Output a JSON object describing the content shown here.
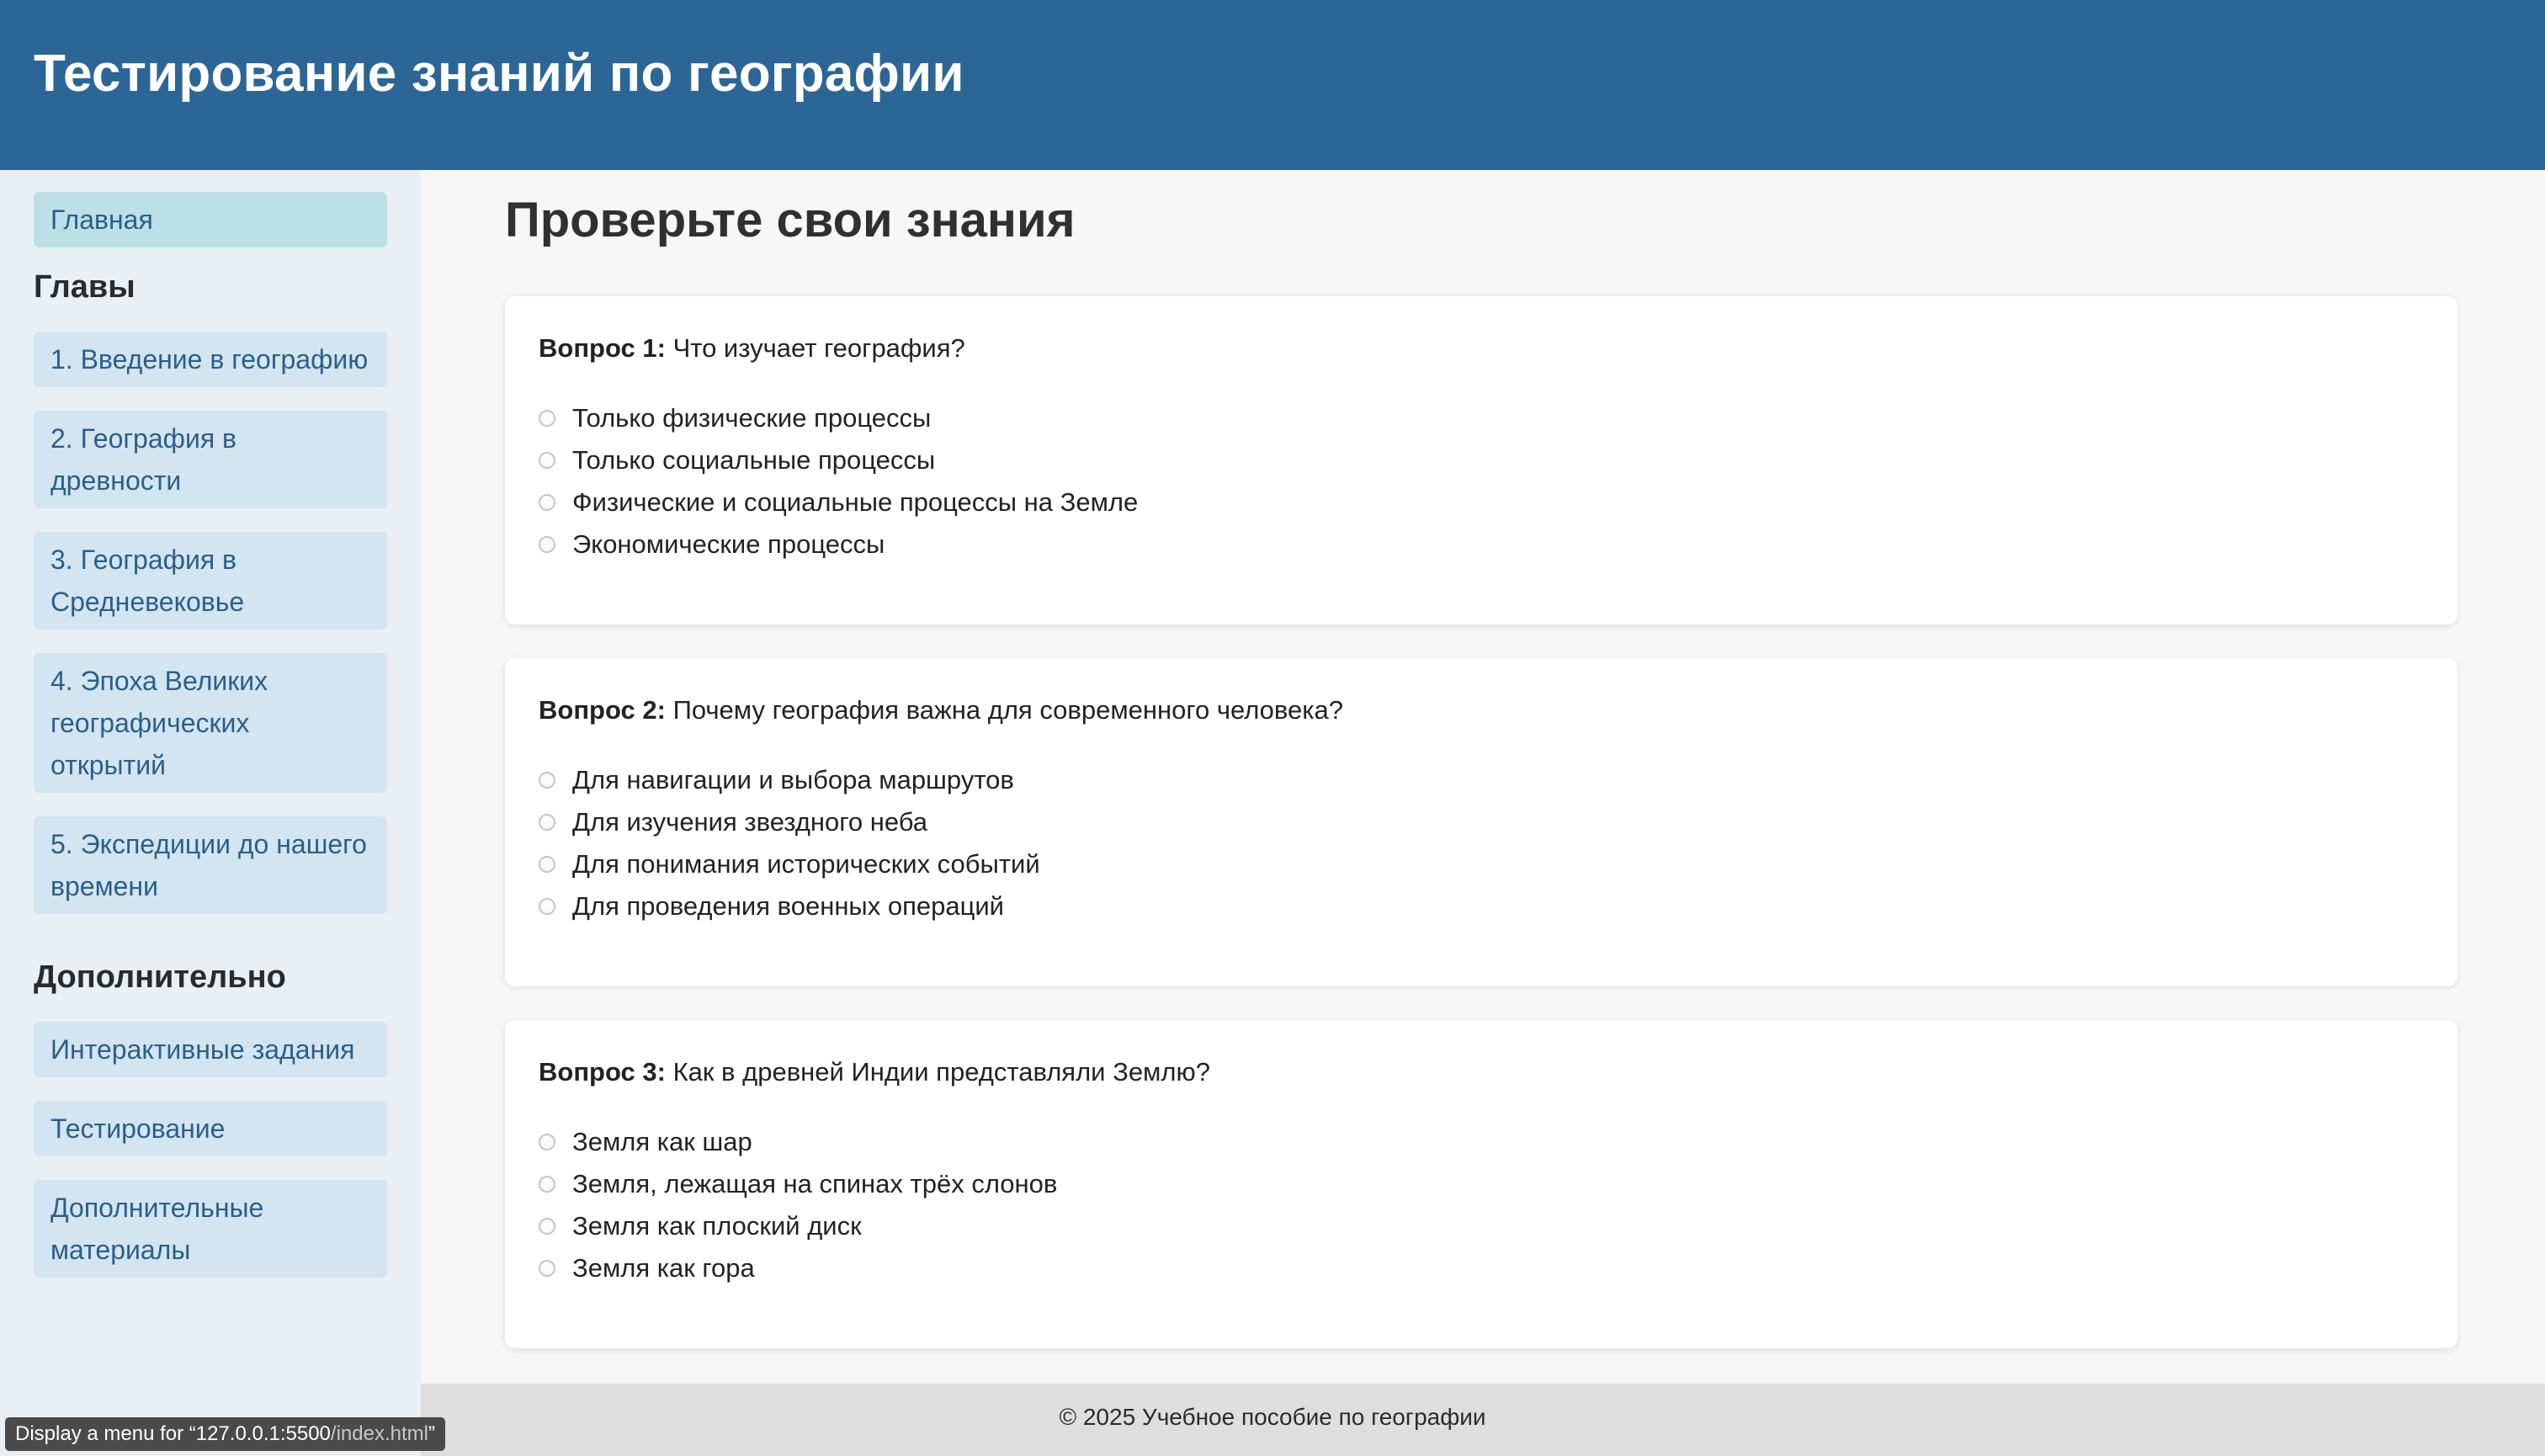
{
  "header": {
    "title": "Тестирование знаний по географии"
  },
  "sidebar": {
    "home": "Главная",
    "chapters_heading": "Главы",
    "chapters": [
      "1. Введение в географию",
      "2. География в древности",
      "3. География в Средневековье",
      "4. Эпоха Великих географических открытий",
      "5. Экспедиции до нашего времени"
    ],
    "extra_heading": "Дополнительно",
    "extra": [
      "Интерактивные задания",
      "Тестирование",
      "Дополнительные материалы"
    ]
  },
  "main": {
    "heading": "Проверьте свои знания",
    "questions": [
      {
        "label": "Вопрос 1:",
        "text": "Что изучает география?",
        "options": [
          "Только физические процессы",
          "Только социальные процессы",
          "Физические и социальные процессы на Земле",
          "Экономические процессы"
        ]
      },
      {
        "label": "Вопрос 2:",
        "text": "Почему география важна для современного человека?",
        "options": [
          "Для навигации и выбора маршрутов",
          "Для изучения звездного неба",
          "Для понимания исторических событий",
          "Для проведения военных операций"
        ]
      },
      {
        "label": "Вопрос 3:",
        "text": "Как в древней Индии представляли Землю?",
        "options": [
          "Земля как шар",
          "Земля, лежащая на спинах трёх слонов",
          "Земля как плоский диск",
          "Земля как гора"
        ]
      }
    ]
  },
  "footer": {
    "text": "© 2025 Учебное пособие по географии"
  },
  "status_bar": {
    "prefix": "Display a menu for “127.0.0.1:5500",
    "path": "/index.html",
    "suffix": "”"
  },
  "colors": {
    "header_bg": "#2b6696",
    "sidebar_bg": "#e8f0f6",
    "nav_item_bg": "#d3e5f0",
    "nav_active_bg": "#bde0e6",
    "nav_text": "#2a5f8b",
    "footer_bg": "#dedede"
  }
}
